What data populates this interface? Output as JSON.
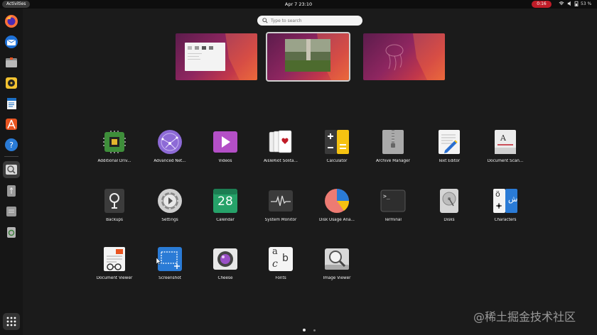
{
  "topbar": {
    "activities": "Activities",
    "clock": "Apr 7 23:10",
    "recording": "0:16",
    "battery": "53 %"
  },
  "search": {
    "placeholder": "Type to search"
  },
  "apps": [
    {
      "id": "additional-drivers",
      "label": "Additional Driv..."
    },
    {
      "id": "advanced-network",
      "label": "Advanced Net..."
    },
    {
      "id": "videos",
      "label": "Videos"
    },
    {
      "id": "aisleriot",
      "label": "AisleRiot Solita..."
    },
    {
      "id": "calculator",
      "label": "Calculator"
    },
    {
      "id": "archive-manager",
      "label": "Archive Manager"
    },
    {
      "id": "text-editor",
      "label": "Text Editor"
    },
    {
      "id": "document-scanner",
      "label": "Document Scan..."
    },
    {
      "id": "backups",
      "label": "Backups"
    },
    {
      "id": "settings",
      "label": "Settings"
    },
    {
      "id": "calendar",
      "label": "Calendar",
      "day": "28"
    },
    {
      "id": "system-monitor",
      "label": "System Monitor"
    },
    {
      "id": "disk-usage",
      "label": "Disk Usage Ana..."
    },
    {
      "id": "terminal",
      "label": "Terminal",
      "prompt": ">_"
    },
    {
      "id": "disks",
      "label": "Disks"
    },
    {
      "id": "characters",
      "label": "Characters",
      "glyph_a": "ö",
      "glyph_b": "ش"
    },
    {
      "id": "document-viewer",
      "label": "Document Viewer"
    },
    {
      "id": "screenshot",
      "label": "Screenshot"
    },
    {
      "id": "cheese",
      "label": "Cheese"
    },
    {
      "id": "fonts",
      "label": "Fonts",
      "glyph_a": "a",
      "glyph_b": "b",
      "glyph_c": "c"
    },
    {
      "id": "image-viewer",
      "label": "Image Viewer"
    }
  ],
  "dock": [
    "firefox",
    "thunderbird",
    "files",
    "rhythmbox",
    "writer",
    "app-center",
    "help",
    "image-viewer",
    "usb-drive",
    "disk",
    "trash"
  ],
  "pager": {
    "pages": 2,
    "current": 1
  },
  "watermark": "@稀土掘金技术社区",
  "colors": {
    "accent": "#e95420",
    "record": "#c01c28"
  }
}
